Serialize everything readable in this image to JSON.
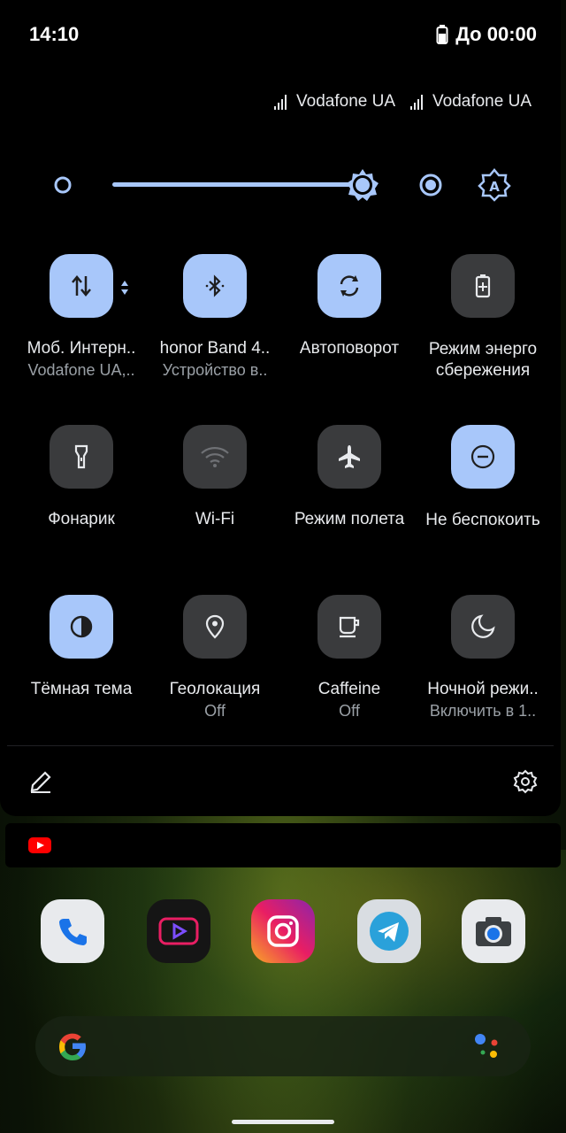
{
  "status_bar": {
    "time": "14:10",
    "battery_text": "До 00:00"
  },
  "carriers": [
    "Vodafone UA",
    "Vodafone UA"
  ],
  "brightness": {
    "level": 0.92
  },
  "tiles": [
    {
      "label": "Моб. Интерн..",
      "sub": "Vodafone UA,..",
      "state": "on",
      "icon": "data-arrows-icon"
    },
    {
      "label": "honor Band 4..",
      "sub": "Устройство в..",
      "state": "on",
      "icon": "bluetooth-icon"
    },
    {
      "label": "Автоповорот",
      "sub": "",
      "state": "on",
      "icon": "auto-rotate-icon"
    },
    {
      "label": "Режим энерго сбережения",
      "sub": "",
      "state": "off",
      "icon": "battery-saver-icon"
    },
    {
      "label": "Фонарик",
      "sub": "",
      "state": "off",
      "icon": "flashlight-icon"
    },
    {
      "label": "Wi-Fi",
      "sub": "",
      "state": "off",
      "icon": "wifi-icon"
    },
    {
      "label": "Режим полета",
      "sub": "",
      "state": "off",
      "icon": "airplane-icon"
    },
    {
      "label": "Не беспокоить",
      "sub": "",
      "state": "on",
      "icon": "do-not-disturb-icon"
    },
    {
      "label": "Тёмная тема",
      "sub": "",
      "state": "on",
      "icon": "dark-theme-icon"
    },
    {
      "label": "Геолокация",
      "sub": "Off",
      "state": "off",
      "icon": "location-icon"
    },
    {
      "label": "Caffeine",
      "sub": "Off",
      "state": "off",
      "icon": "coffee-icon"
    },
    {
      "label": "Ночной режи..",
      "sub": "Включить в 1..",
      "state": "off",
      "icon": "night-mode-icon"
    }
  ],
  "colors": {
    "accent": "#a8c7fa",
    "tile_off": "#3a3b3d",
    "panel": "#000000"
  }
}
